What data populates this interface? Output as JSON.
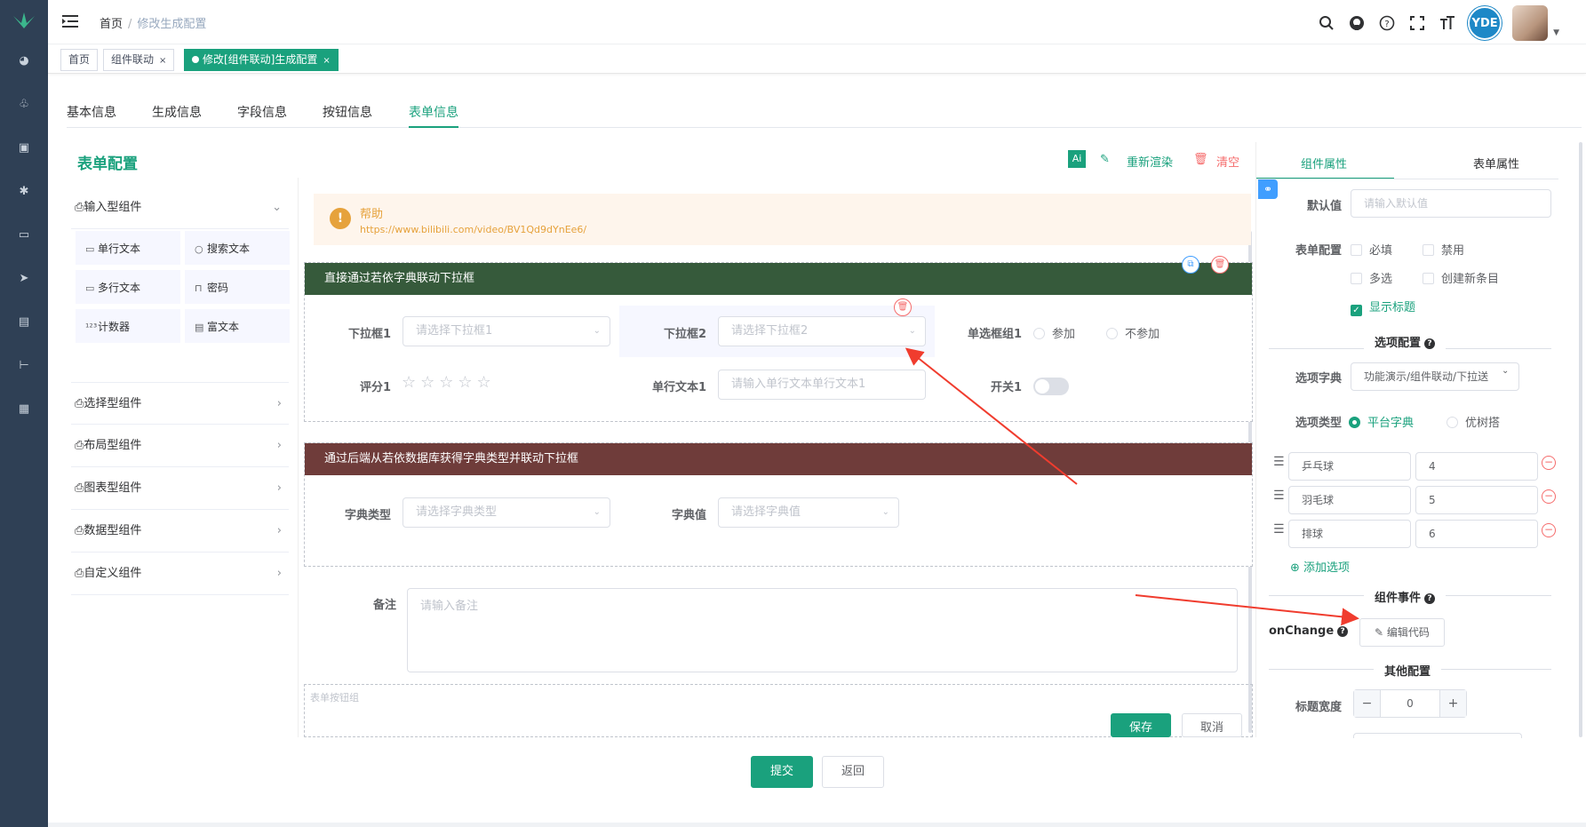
{
  "breadcrumb": {
    "home": "首页",
    "separator": "/",
    "current": "修改生成配置"
  },
  "header": {
    "brand_logo_text": "YDE"
  },
  "tags": [
    {
      "label": "首页"
    },
    {
      "label": "组件联动",
      "close": "×"
    },
    {
      "label": "修改[组件联动]生成配置",
      "close": "×"
    }
  ],
  "main_tabs": [
    "基本信息",
    "生成信息",
    "字段信息",
    "按钮信息",
    "表单信息"
  ],
  "left": {
    "title": "表单配置",
    "input_group": "输入型组件",
    "components": [
      "单行文本",
      "搜索文本",
      "多行文本",
      "密码",
      "计数器",
      "富文本"
    ],
    "categories": [
      "选择型组件",
      "布局型组件",
      "图表型组件",
      "数据型组件",
      "自定义组件"
    ]
  },
  "toolbar": {
    "ai_label": "Ai",
    "rerender": "重新渲染",
    "clear": "清空"
  },
  "help": {
    "title": "帮助",
    "link": "https://www.bilibili.com/video/BV1Qd9dYnEe6/"
  },
  "card1": {
    "title": "直接通过若依字典联动下拉框",
    "select1_label": "下拉框1",
    "select1_placeholder": "请选择下拉框1",
    "select2_label": "下拉框2",
    "select2_placeholder": "请选择下拉框2",
    "radio_label": "单选框组1",
    "radio_options": [
      "参加",
      "不参加"
    ],
    "rate_label": "评分1",
    "rate_stars": "☆☆☆☆☆",
    "text_label": "单行文本1",
    "text_placeholder": "请输入单行文本单行文本1",
    "switch_label": "开关1"
  },
  "card2": {
    "title": "通过后端从若依数据库获得字典类型并联动下拉框",
    "dict_type_label": "字典类型",
    "dict_type_placeholder": "请选择字典类型",
    "dict_value_label": "字典值",
    "dict_value_placeholder": "请选择字典值"
  },
  "remark": {
    "label": "备注",
    "placeholder": "请输入备注"
  },
  "button_group": {
    "label": "表单按钮组",
    "save": "保存",
    "cancel": "取消"
  },
  "footer": {
    "submit": "提交",
    "back": "返回"
  },
  "right": {
    "tabs": [
      "组件属性",
      "表单属性"
    ],
    "default_label": "默认值",
    "default_placeholder": "请输入默认值",
    "form_config_label": "表单配置",
    "checks": [
      "必填",
      "禁用",
      "多选",
      "创建新条目",
      "显示标题"
    ],
    "options_section": "选项配置",
    "dict_label": "选项字典",
    "dict_value": "功能演示/组件联动/下拉送",
    "type_label": "选项类型",
    "type_options": [
      "平台字典",
      "优树搭"
    ],
    "options": [
      {
        "label": "乒乓球",
        "value": "4"
      },
      {
        "label": "羽毛球",
        "value": "5"
      },
      {
        "label": "排球",
        "value": "6"
      }
    ],
    "add_option": "添加选项",
    "events_section": "组件事件",
    "onchange_label": "onChange",
    "edit_code": "编辑代码",
    "other_section": "其他配置",
    "title_width_label": "标题宽度",
    "title_width_value": "0"
  },
  "colors": {
    "accent": "#1aa17d",
    "card1_head": "#365a3b",
    "card2_head": "#6f3c3a",
    "sidebar": "#2f4055",
    "warning": "#e6a23c",
    "danger": "#f56c6c"
  }
}
